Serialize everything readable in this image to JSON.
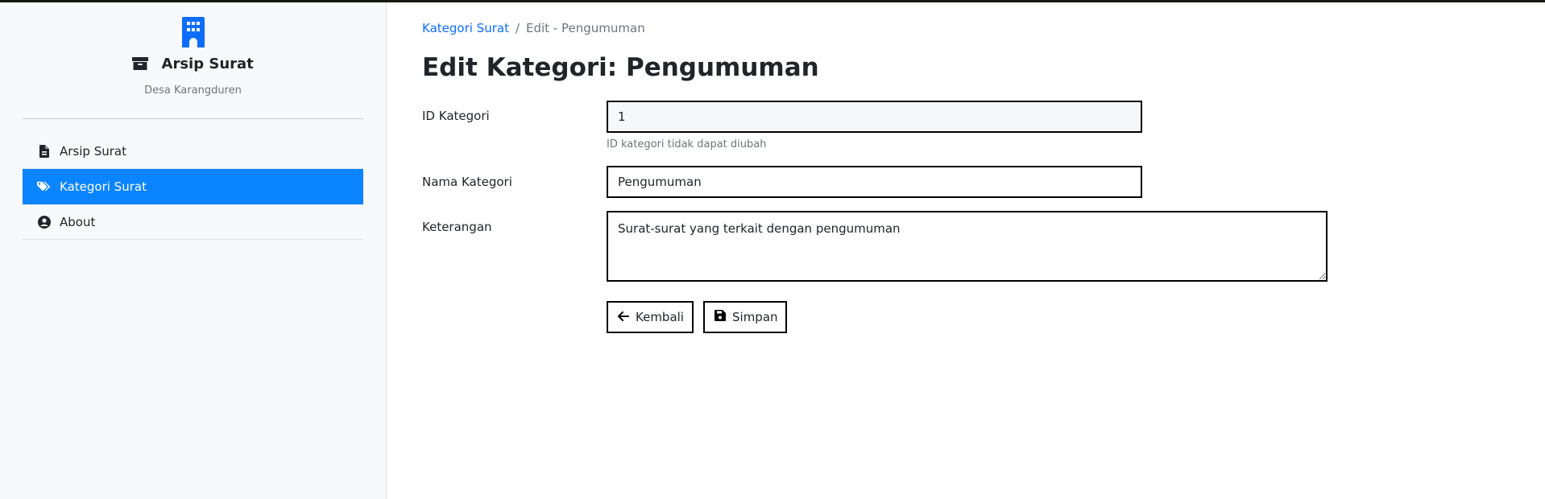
{
  "sidebar": {
    "icon": "building-icon",
    "app_title": "Arsip Surat",
    "subtitle": "Desa Karangduren",
    "items": [
      {
        "label": "Arsip Surat",
        "icon": "file-icon",
        "active": false
      },
      {
        "label": "Kategori Surat",
        "icon": "tags-icon",
        "active": true
      },
      {
        "label": "About",
        "icon": "user-circle-icon",
        "active": false
      }
    ]
  },
  "breadcrumb": {
    "parent": "Kategori Surat",
    "separator": "/",
    "current": "Edit - Pengumuman"
  },
  "page_title": "Edit Kategori: Pengumuman",
  "form": {
    "id": {
      "label": "ID Kategori",
      "value": "1",
      "help": "ID kategori tidak dapat diubah"
    },
    "name": {
      "label": "Nama Kategori",
      "value": "Pengumuman"
    },
    "description": {
      "label": "Keterangan",
      "value": "Surat-surat yang terkait dengan pengumuman"
    }
  },
  "buttons": {
    "back": "Kembali",
    "save": "Simpan"
  },
  "colors": {
    "accent": "#0a84ff",
    "link": "#0d6efd",
    "sidebar_bg": "#f8f9fa",
    "muted_text": "#6c757d"
  }
}
